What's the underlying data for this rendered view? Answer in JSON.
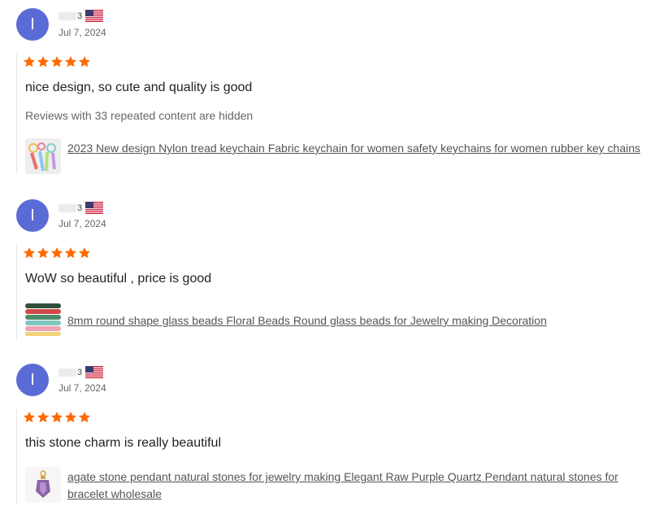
{
  "reviews": [
    {
      "avatar_letter": "I",
      "name_suffix": "3",
      "flag": "us-flag-icon",
      "date": "Jul 7, 2024",
      "rating": 5,
      "text": "nice design, so cute and quality is good",
      "hidden_note": "Reviews with 33 repeated content are hidden",
      "product_title": "2023 New design Nylon tread keychain Fabric keychain for women safety keychains for women rubber key chains"
    },
    {
      "avatar_letter": "I",
      "name_suffix": "3",
      "flag": "us-flag-icon",
      "date": "Jul 7, 2024",
      "rating": 5,
      "text": "WoW so beautiful , price is good",
      "product_title": "8mm round shape glass beads Floral Beads Round glass beads for Jewelry making Decoration"
    },
    {
      "avatar_letter": "I",
      "name_suffix": "3",
      "flag": "us-flag-icon",
      "date": "Jul 7, 2024",
      "rating": 5,
      "text": "this stone charm is really beautiful",
      "product_title": "agate stone pendant natural stones for jewelry making Elegant Raw Purple Quartz Pendant natural stones for bracelet wholesale"
    }
  ],
  "colors": {
    "avatar": "#5b6bd6",
    "star": "#ff6a00",
    "divider": "#e6e6e6"
  }
}
